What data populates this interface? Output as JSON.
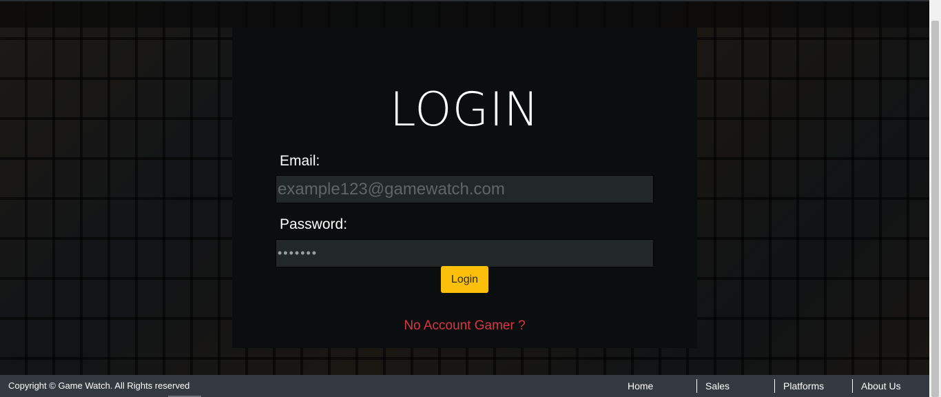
{
  "login": {
    "title": "LOGIN",
    "email_label": "Email:",
    "email_placeholder": "example123@gamewatch.com",
    "password_label": "Password:",
    "password_value": "•••••••",
    "login_button": "Login",
    "no_account_link": "No Account Gamer ?"
  },
  "footer": {
    "copyright": "Copyright © Game Watch. All Rights reserved",
    "nav": [
      {
        "label": "Home"
      },
      {
        "label": "Sales"
      },
      {
        "label": "Platforms"
      },
      {
        "label": "About Us"
      }
    ]
  },
  "colors": {
    "accent_button": "#fcc00a",
    "link_danger": "#dc3545",
    "footer_bg": "#343a40",
    "card_bg": "#0b0e0e"
  }
}
